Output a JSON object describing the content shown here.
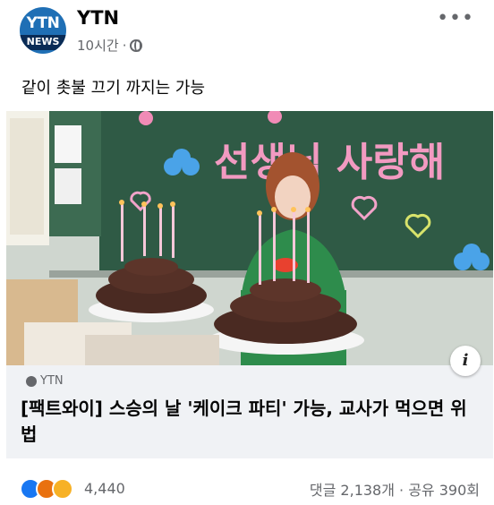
{
  "post": {
    "page_name": "YTN",
    "avatar_top": "YTN",
    "avatar_bottom": "NEWS",
    "time": "10시간",
    "dot": "·",
    "caption": "같이 촛불 끄기 까지는 가능"
  },
  "media": {
    "board_text": "선생님 사랑해"
  },
  "link": {
    "domain": "YTN",
    "title": "[팩트와이] 스승의 날 '케이크 파티' 가능, 교사가 먹으면 위법",
    "info": "i"
  },
  "footer": {
    "reaction_count": "4,440",
    "stats": "댓글 2,138개 · 공유 390회"
  },
  "icons": [
    "globe-icon",
    "more-icon",
    "link-icon",
    "info-icon",
    "like-reaction-icon",
    "angry-reaction-icon",
    "haha-reaction-icon"
  ]
}
